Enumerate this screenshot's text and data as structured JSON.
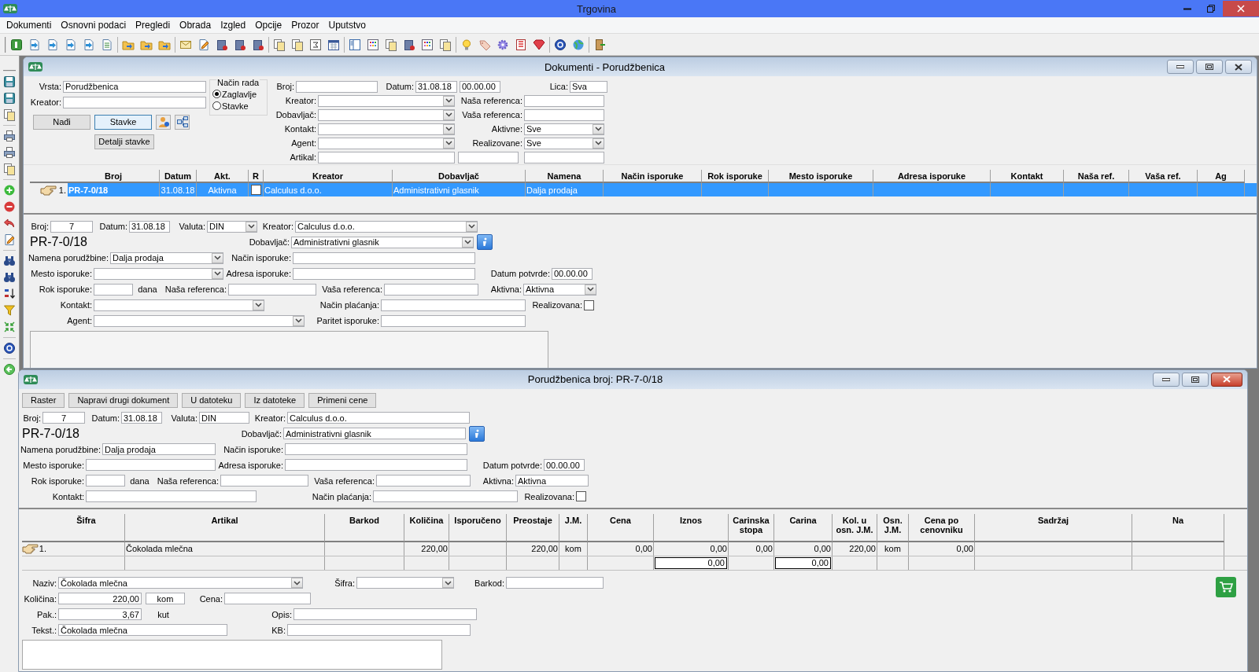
{
  "window": {
    "title": "Trgovina"
  },
  "menu": [
    "Dokumenti",
    "Osnovni podaci",
    "Pregledi",
    "Obrada",
    "Izgled",
    "Opcije",
    "Prozor",
    "Uputstvo"
  ],
  "documents_window": {
    "title": "Dokumenti - Porudžbenica",
    "filter": {
      "vrsta": {
        "label": "Vrsta:",
        "kind": "text",
        "value": "Porudžbenica"
      },
      "kreator": {
        "label": "Kreator:",
        "kind": "text"
      },
      "mode": {
        "label": "Način rada",
        "options": [
          {
            "label": "Zaglavlje",
            "selected": true
          },
          {
            "label": "Stavke",
            "selected": false
          }
        ]
      },
      "buttons": [
        {
          "label": "Nađi",
          "focused": false
        },
        {
          "label": "Stavke",
          "focused": true
        }
      ],
      "detail_button": "Detalji stavke",
      "broj": {
        "label": "Broj:",
        "kind": "text"
      },
      "datum": {
        "label": "Datum:",
        "kind": "text",
        "value": "31.08.18"
      },
      "vreme": {
        "kind": "text",
        "value": "00.00.00"
      },
      "lica": {
        "label": "Lica:",
        "kind": "text",
        "value": "Sva"
      },
      "rows": [
        [
          {
            "label": "Kreator:",
            "kind": "combo"
          },
          {
            "label": "Naša referenca:",
            "kind": "text"
          }
        ],
        [
          {
            "label": "Dobavljač:",
            "kind": "combo"
          },
          {
            "label": "Vaša referenca:",
            "kind": "text"
          }
        ],
        [
          {
            "label": "Kontakt:",
            "kind": "combo"
          },
          {
            "label": "Aktivne:",
            "kind": "combo",
            "value": "Sve"
          }
        ],
        [
          {
            "label": "Agent:",
            "kind": "combo"
          },
          {
            "label": "Realizovane:",
            "kind": "combo",
            "value": "Sve"
          }
        ]
      ],
      "artikal": [
        {
          "label": "Artikal:",
          "kind": "text"
        },
        {
          "kind": "text"
        },
        {
          "kind": "text"
        }
      ]
    },
    "grid": {
      "columns": [
        "Broj",
        "Datum",
        "Akt.",
        "R",
        "Kreator",
        "Dobavljač",
        "Namena",
        "Način isporuke",
        "Rok isporuke",
        "Mesto isporuke",
        "Adresa isporuke",
        "Kontakt",
        "Naša ref.",
        "Vaša ref.",
        "Ag"
      ],
      "rows": [
        {
          "number": "1.",
          "selected": true,
          "realizovan": false,
          "broj": "PR-7-0/18",
          "datum": "31.08.18",
          "akt": "Aktivna",
          "kreator": "Calculus d.o.o.",
          "dobavljac": "Administrativni glasnik",
          "namena": "Dalja prodaja"
        }
      ]
    },
    "form": {
      "broj": {
        "label": "Broj:",
        "kind": "text",
        "value": "7"
      },
      "datum": {
        "label": "Datum:",
        "kind": "text",
        "value": "31.08.18"
      },
      "valuta": {
        "label": "Valuta:",
        "kind": "combo",
        "value": "DIN"
      },
      "kreator": {
        "label": "Kreator:",
        "kind": "combo",
        "value": "Calculus d.o.o."
      },
      "code": "PR-7-0/18",
      "dobavljac": {
        "label": "Dobavljač:",
        "kind": "combo",
        "value": "Administrativni glasnik"
      },
      "namena": {
        "label": "Namena porudžbine:",
        "kind": "combo",
        "value": "Dalja prodaja"
      },
      "nacin_isporuke": {
        "label": "Način isporuke:",
        "kind": "text"
      },
      "mesto": {
        "label": "Mesto isporuke:",
        "kind": "combo"
      },
      "adresa": {
        "label": "Adresa isporuke:",
        "kind": "text"
      },
      "datum_potvrde": {
        "label": "Datum potvrde:",
        "kind": "text",
        "value": "00.00.00"
      },
      "rok": {
        "label": "Rok isporuke:",
        "kind": "text"
      },
      "dana": "dana",
      "nasa_ref": {
        "label": "Naša referenca:",
        "kind": "text"
      },
      "vasa_ref": {
        "label": "Vaša referenca:",
        "kind": "text"
      },
      "aktivna": {
        "label": "Aktivna:",
        "kind": "combo",
        "value": "Aktivna"
      },
      "kontakt": {
        "label": "Kontakt:",
        "kind": "combo"
      },
      "nacin_placanja": {
        "label": "Način plaćanja:",
        "kind": "text"
      },
      "realizovana": {
        "label": "Realizovana:",
        "kind": "check",
        "checked": false
      },
      "agent": {
        "label": "Agent:",
        "kind": "combo"
      },
      "paritet": {
        "label": "Paritet isporuke:",
        "kind": "text"
      }
    }
  },
  "order_window": {
    "title": "Porudžbenica broj: PR-7-0/18",
    "buttons": [
      "Raster",
      "Napravi drugi dokument",
      "U datoteku",
      "Iz datoteke",
      "Primeni cene"
    ],
    "form": {
      "broj": {
        "label": "Broj:",
        "kind": "text",
        "value": "7"
      },
      "datum": {
        "label": "Datum:",
        "kind": "text",
        "value": "31.08.18"
      },
      "valuta": {
        "label": "Valuta:",
        "kind": "text",
        "value": "DIN"
      },
      "kreator": {
        "label": "Kreator:",
        "kind": "text",
        "value": "Calculus d.o.o."
      },
      "code": "PR-7-0/18",
      "dobavljac": {
        "label": "Dobavljač:",
        "kind": "text",
        "value": "Administrativni glasnik"
      },
      "namena": {
        "label": "Namena porudžbine:",
        "kind": "text",
        "value": "Dalja prodaja"
      },
      "nacin_isporuke": {
        "label": "Način isporuke:",
        "kind": "text"
      },
      "mesto": {
        "label": "Mesto isporuke:",
        "kind": "text"
      },
      "adresa": {
        "label": "Adresa isporuke:",
        "kind": "text"
      },
      "datum_potvrde": {
        "label": "Datum potvrde:",
        "kind": "text",
        "value": "00.00.00"
      },
      "rok": {
        "label": "Rok isporuke:",
        "kind": "text"
      },
      "dana": "dana",
      "nasa_ref": {
        "label": "Naša referenca:",
        "kind": "text"
      },
      "vasa_ref": {
        "label": "Vaša referenca:",
        "kind": "text"
      },
      "aktivna": {
        "label": "Aktivna:",
        "kind": "text",
        "value": "Aktivna"
      },
      "kontakt": {
        "label": "Kontakt:",
        "kind": "text"
      },
      "nacin_placanja": {
        "label": "Način plaćanja:",
        "kind": "text"
      },
      "realizovana": {
        "label": "Realizovana:",
        "kind": "check",
        "checked": false
      }
    },
    "items": {
      "columns": [
        "Šifra",
        "Artikal",
        "Barkod",
        "Količina",
        "Isporučeno",
        "Preostaje",
        "J.M.",
        "Cena",
        "Iznos",
        "Carinska stopa",
        "Carina",
        "Kol. u osn. J.M.",
        "Osn. J.M.",
        "Cena po cenovniku",
        "Sadržaj",
        "Na"
      ],
      "rows": [
        {
          "number": "1.",
          "cells": [
            "",
            "Čokolada mlečna",
            "",
            "220,00",
            "",
            "220,00",
            "kom",
            "0,00",
            "0,00",
            "0,00",
            "0,00",
            "220,00",
            "kom",
            "0,00",
            "",
            ""
          ]
        }
      ],
      "totals": {
        "iznos": "0,00",
        "carina": "0,00"
      }
    },
    "item_form": {
      "naziv": {
        "label": "Naziv:",
        "kind": "combo",
        "value": "Čokolada mlečna"
      },
      "sifra": {
        "label": "Šifra:",
        "kind": "combo"
      },
      "barkod": {
        "label": "Barkod:",
        "kind": "text"
      },
      "kolicina": {
        "label": "Količina:",
        "kind": "text",
        "value": "220,00"
      },
      "jm": {
        "kind": "text",
        "value": "kom"
      },
      "cena": {
        "label": "Cena:",
        "kind": "text"
      },
      "pak": {
        "label": "Pak.:",
        "kind": "text",
        "value": "3,67"
      },
      "pak_unit": "kut",
      "opis": {
        "label": "Opis:",
        "kind": "text"
      },
      "tekst": {
        "label": "Tekst.:",
        "kind": "text",
        "value": "Čokolada mlečna"
      },
      "kb": {
        "label": "KB:",
        "kind": "text"
      }
    }
  }
}
